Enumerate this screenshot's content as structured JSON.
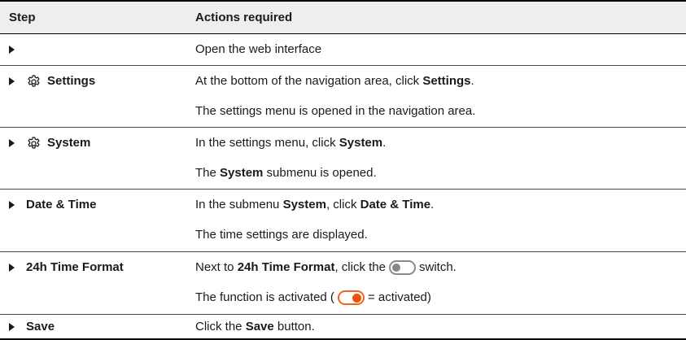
{
  "header": {
    "col1": "Step",
    "col2": "Actions required"
  },
  "rows": [
    {
      "step": "",
      "icon": "",
      "lines": [
        {
          "parts": [
            {
              "t": "Open the web interface",
              "b": false
            }
          ]
        }
      ]
    },
    {
      "step": "Settings",
      "icon": "gear-icon",
      "lines": [
        {
          "parts": [
            {
              "t": "At the bottom of the navigation area, click ",
              "b": false
            },
            {
              "t": "Settings",
              "b": true
            },
            {
              "t": ".",
              "b": false
            }
          ]
        },
        {
          "parts": [
            {
              "t": "The settings menu is opened in the navigation area.",
              "b": false
            }
          ]
        }
      ]
    },
    {
      "step": "System",
      "icon": "gear-icon",
      "lines": [
        {
          "parts": [
            {
              "t": "In the settings menu, click ",
              "b": false
            },
            {
              "t": "System",
              "b": true
            },
            {
              "t": ".",
              "b": false
            }
          ]
        },
        {
          "parts": [
            {
              "t": "The ",
              "b": false
            },
            {
              "t": "System",
              "b": true
            },
            {
              "t": " submenu is opened.",
              "b": false
            }
          ]
        }
      ]
    },
    {
      "step": "Date & Time",
      "icon": "",
      "lines": [
        {
          "parts": [
            {
              "t": "In the submenu ",
              "b": false
            },
            {
              "t": "System",
              "b": true
            },
            {
              "t": ", click ",
              "b": false
            },
            {
              "t": "Date & Time",
              "b": true
            },
            {
              "t": ".",
              "b": false
            }
          ]
        },
        {
          "parts": [
            {
              "t": "The time settings are displayed.",
              "b": false
            }
          ]
        }
      ]
    },
    {
      "step": "24h Time Format",
      "icon": "",
      "lines": [
        {
          "parts": [
            {
              "t": "Next to ",
              "b": false
            },
            {
              "t": "24h Time Format",
              "b": true
            },
            {
              "t": ", click the",
              "b": false
            },
            {
              "sw": "off"
            },
            {
              "t": "switch.",
              "b": false
            }
          ]
        },
        {
          "parts": [
            {
              "t": "The function is activated (",
              "b": false
            },
            {
              "sw": "on"
            },
            {
              "t": "= activated)",
              "b": false
            }
          ]
        }
      ]
    },
    {
      "step": "Save",
      "icon": "",
      "lines": [
        {
          "parts": [
            {
              "t": "Click the ",
              "b": false
            },
            {
              "t": "Save",
              "b": true
            },
            {
              "t": " button.",
              "b": false
            }
          ]
        }
      ]
    }
  ]
}
